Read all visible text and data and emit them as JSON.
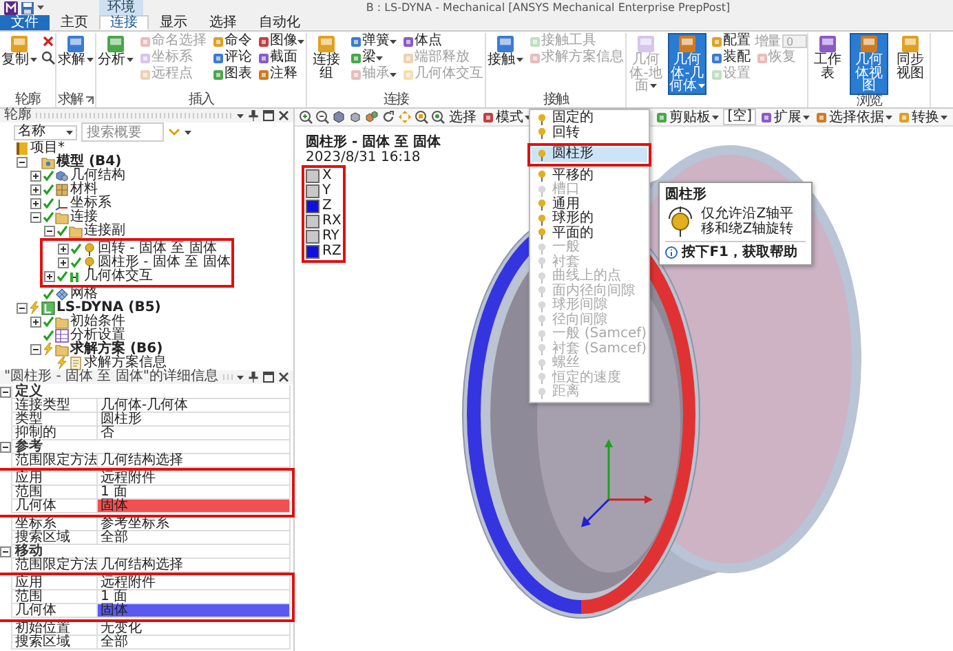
{
  "title_bar": {
    "context_tab": "环境",
    "title": "B : LS-DYNA - Mechanical [ANSYS Mechanical Enterprise PrepPost]"
  },
  "tabs": [
    {
      "label": "文件",
      "kind": "file",
      "selected": false
    },
    {
      "label": "主页",
      "kind": "tab",
      "selected": false
    },
    {
      "label": "连接",
      "kind": "tab",
      "selected": true
    },
    {
      "label": "显示",
      "kind": "tab",
      "selected": false
    },
    {
      "label": "选择",
      "kind": "tab",
      "selected": false
    },
    {
      "label": "自动化",
      "kind": "tab",
      "selected": false
    }
  ],
  "ribbon": [
    {
      "label": "轮廓",
      "items": [
        {
          "kind": "large",
          "label": "复制",
          "dropdown": true,
          "disabled": false,
          "pressed": false
        },
        {
          "kind": "delete"
        },
        {
          "kind": "find"
        }
      ]
    },
    {
      "label": "求解",
      "launcher": true,
      "items": [
        {
          "kind": "large",
          "label": "求解",
          "dropdown": true,
          "disabled": false,
          "pressed": false
        }
      ]
    },
    {
      "label": "插入",
      "items": [
        {
          "kind": "large",
          "label": "分析",
          "dropdown": true,
          "disabled": false,
          "pressed": false
        },
        {
          "kind": "small",
          "label": "命名选择",
          "dropdown": false,
          "disabled": true
        },
        {
          "kind": "small",
          "label": "坐标系",
          "dropdown": false,
          "disabled": true
        },
        {
          "kind": "small",
          "label": "远程点",
          "dropdown": false,
          "disabled": true
        },
        {
          "kind": "small",
          "label": "命令",
          "dropdown": false,
          "disabled": false
        },
        {
          "kind": "small",
          "label": "评论",
          "dropdown": false,
          "disabled": false
        },
        {
          "kind": "small",
          "label": "图表",
          "dropdown": false,
          "disabled": false
        },
        {
          "kind": "small",
          "label": "图像",
          "dropdown": true,
          "disabled": false
        },
        {
          "kind": "small",
          "label": "截面",
          "dropdown": false,
          "disabled": false
        },
        {
          "kind": "small",
          "label": "注释",
          "dropdown": false,
          "disabled": false
        }
      ]
    },
    {
      "label": "连接",
      "items": [
        {
          "kind": "large",
          "label": "连接组",
          "dropdown": false,
          "disabled": false,
          "pressed": false
        },
        {
          "kind": "small",
          "label": "弹簧",
          "dropdown": true,
          "disabled": false
        },
        {
          "kind": "small",
          "label": "梁",
          "dropdown": true,
          "disabled": false
        },
        {
          "kind": "small",
          "label": "轴承",
          "dropdown": true,
          "disabled": true
        },
        {
          "kind": "small",
          "label": "体点",
          "dropdown": false,
          "disabled": false
        },
        {
          "kind": "small",
          "label": "端部释放",
          "dropdown": false,
          "disabled": true
        },
        {
          "kind": "small",
          "label": "几何体交互",
          "dropdown": false,
          "disabled": true
        }
      ]
    },
    {
      "label": "接触",
      "items": [
        {
          "kind": "large",
          "label": "接触",
          "dropdown": true,
          "disabled": false,
          "pressed": false
        },
        {
          "kind": "small",
          "label": "接触工具",
          "dropdown": false,
          "disabled": true
        },
        {
          "kind": "small",
          "label": "求解方案信息",
          "dropdown": false,
          "disabled": true
        }
      ]
    },
    {
      "items": [
        {
          "kind": "large",
          "label": "几何体-地面",
          "dropdown": true,
          "disabled": true,
          "pressed": false
        },
        {
          "kind": "large",
          "label": "几何体-几何体",
          "dropdown": true,
          "disabled": false,
          "pressed": true
        },
        {
          "kind": "small",
          "label": "配置",
          "dropdown": false,
          "disabled": false
        },
        {
          "kind": "small",
          "label": "装配",
          "dropdown": false,
          "disabled": false
        },
        {
          "kind": "small",
          "label": "设置",
          "dropdown": false,
          "disabled": true
        },
        {
          "kind": "field",
          "label": "增量",
          "value": "0",
          "disabled": true
        },
        {
          "kind": "small",
          "label": "恢复",
          "dropdown": false,
          "disabled": true
        }
      ]
    },
    {
      "label": "浏览",
      "items": [
        {
          "kind": "large",
          "label": "工作表",
          "dropdown": false,
          "disabled": false,
          "pressed": false
        },
        {
          "kind": "large",
          "label": "几何体视图",
          "dropdown": false,
          "disabled": false,
          "pressed": true
        },
        {
          "kind": "large",
          "label": "同步视图",
          "dropdown": false,
          "disabled": false,
          "pressed": false
        }
      ]
    }
  ],
  "outline": {
    "title": "轮廓",
    "filter": "名称",
    "search": {
      "placeholder": "搜索概要"
    },
    "tree": [
      {
        "label": "项目*",
        "kind": "project",
        "children": [
          {
            "label": "模型 (B4)",
            "kind": "model",
            "bold": true,
            "expanded": true,
            "children": [
              {
                "label": "几何结构",
                "kind": "geometry",
                "solved": true,
                "expanded": false
              },
              {
                "label": "材料",
                "kind": "material",
                "solved": true,
                "expanded": false
              },
              {
                "label": "坐标系",
                "kind": "coordinates",
                "solved": true,
                "expanded": false
              },
              {
                "label": "连接",
                "kind": "folder",
                "solved": true,
                "expanded": true,
                "children": [
                  {
                    "label": "连接副",
                    "kind": "folder",
                    "solved": true,
                    "expanded": true,
                    "children": [
                      {
                        "label": "回转 - 固体 至 固体",
                        "kind": "joint",
                        "solved": true,
                        "expanded": false,
                        "framed": true
                      },
                      {
                        "label": "圆柱形 - 固体 至 固体",
                        "kind": "joint",
                        "solved": true,
                        "expanded": false,
                        "framed": true
                      }
                    ]
                  },
                  {
                    "label": "几何体交互",
                    "kind": "interaction",
                    "solved": true,
                    "expanded": false,
                    "framed": true
                  }
                ]
              },
              {
                "label": "网格",
                "kind": "mesh",
                "solved": true
              }
            ]
          },
          {
            "label": "LS-DYNA (B5)",
            "kind": "system",
            "bold": true,
            "solved": false,
            "expanded": true,
            "children": [
              {
                "label": "初始条件",
                "kind": "folder",
                "solved": true,
                "expanded": false
              },
              {
                "label": "分析设置",
                "kind": "settings",
                "solved": true
              },
              {
                "label": "求解方案 (B6)",
                "kind": "folder",
                "bold": true,
                "solved": false,
                "expanded": true,
                "children": [
                  {
                    "label": "求解方案信息",
                    "kind": "info",
                    "solved": false
                  }
                ]
              }
            ]
          }
        ]
      }
    ]
  },
  "details": {
    "title": "\"圆柱形 - 固体 至 固体\"的详细信息",
    "rows": [
      {
        "kind": "section",
        "name": "定义",
        "expanded": true
      },
      {
        "kind": "row",
        "name": "连接类型",
        "value": "几何体-几何体"
      },
      {
        "kind": "row",
        "name": "类型",
        "value": "圆柱形"
      },
      {
        "kind": "row",
        "name": "抑制的",
        "value": "否"
      },
      {
        "kind": "section",
        "name": "参考",
        "expanded": true
      },
      {
        "kind": "row",
        "name": "范围限定方法",
        "value": "几何结构选择"
      },
      {
        "kind": "row",
        "name": "应用",
        "value": "远程附件",
        "framed": true
      },
      {
        "kind": "row",
        "name": "范围",
        "value": "1 面",
        "framed": true
      },
      {
        "kind": "row",
        "name": "几何体",
        "value": "固体",
        "color": "#f25050",
        "framed": true
      },
      {
        "kind": "row",
        "name": "坐标系",
        "value": "参考坐标系"
      },
      {
        "kind": "row",
        "name": "搜索区域",
        "value": "全部"
      },
      {
        "kind": "section",
        "name": "移动",
        "expanded": true
      },
      {
        "kind": "row",
        "name": "范围限定方法",
        "value": "几何结构选择"
      },
      {
        "kind": "row",
        "name": "应用",
        "value": "远程附件",
        "framed": true
      },
      {
        "kind": "row",
        "name": "范围",
        "value": "1 面",
        "framed": true
      },
      {
        "kind": "row",
        "name": "几何体",
        "value": "固体",
        "color": "#5a5af2",
        "framed": true
      },
      {
        "kind": "row",
        "name": "初始位置",
        "value": "无变化"
      },
      {
        "kind": "row",
        "name": "搜索区域",
        "value": "全部"
      }
    ]
  },
  "graphics": {
    "toolbar": {
      "left": [
        {
          "label": "选择",
          "kind": "button"
        },
        {
          "label": "模式",
          "kind": "dropdown"
        }
      ],
      "right": [
        {
          "label": "剪贴板",
          "kind": "dropdown"
        },
        {
          "label": "[空]",
          "kind": "field"
        },
        {
          "label": "扩展",
          "kind": "dropdown"
        },
        {
          "label": "选择依据",
          "kind": "dropdown"
        },
        {
          "label": "转换",
          "kind": "dropdown"
        }
      ]
    },
    "heading": "圆柱形 - 固体 至 固体",
    "timestamp": "2023/8/31 16:18",
    "legend": {
      "framed": true,
      "items": [
        {
          "label": "X",
          "free": false
        },
        {
          "label": "Y",
          "free": false
        },
        {
          "label": "Z",
          "free": true
        },
        {
          "label": "RX",
          "free": false
        },
        {
          "label": "RY",
          "free": false
        },
        {
          "label": "RZ",
          "free": true
        }
      ]
    }
  },
  "joint_menu": {
    "items": [
      {
        "label": "固定的",
        "disabled": false,
        "selected": false
      },
      {
        "label": "回转",
        "disabled": false,
        "selected": false
      },
      {
        "label": "圆柱形",
        "disabled": false,
        "selected": true,
        "framed": true
      },
      {
        "label": "平移的",
        "disabled": false,
        "selected": false
      },
      {
        "label": "槽口",
        "disabled": true,
        "selected": false
      },
      {
        "label": "通用",
        "disabled": false,
        "selected": false
      },
      {
        "label": "球形的",
        "disabled": false,
        "selected": false
      },
      {
        "label": "平面的",
        "disabled": false,
        "selected": false
      },
      {
        "label": "一般",
        "disabled": true,
        "selected": false
      },
      {
        "label": "衬套",
        "disabled": true,
        "selected": false
      },
      {
        "label": "曲线上的点",
        "disabled": true,
        "selected": false
      },
      {
        "label": "面内径向间隙",
        "disabled": true,
        "selected": false
      },
      {
        "label": "球形间隙",
        "disabled": true,
        "selected": false
      },
      {
        "label": "径向间隙",
        "disabled": true,
        "selected": false
      },
      {
        "label": "一般 (Samcef)",
        "disabled": true,
        "selected": false
      },
      {
        "label": "衬套 (Samcef)",
        "disabled": true,
        "selected": false
      },
      {
        "label": "螺丝",
        "disabled": true,
        "selected": false
      },
      {
        "label": "恒定的速度",
        "disabled": true,
        "selected": false
      },
      {
        "label": "距离",
        "disabled": true,
        "selected": false
      }
    ],
    "tooltip": {
      "title": "圆柱形",
      "text": "仅允许沿Z轴平移和绕Z轴旋转",
      "help": "按下F1，获取帮助"
    }
  }
}
